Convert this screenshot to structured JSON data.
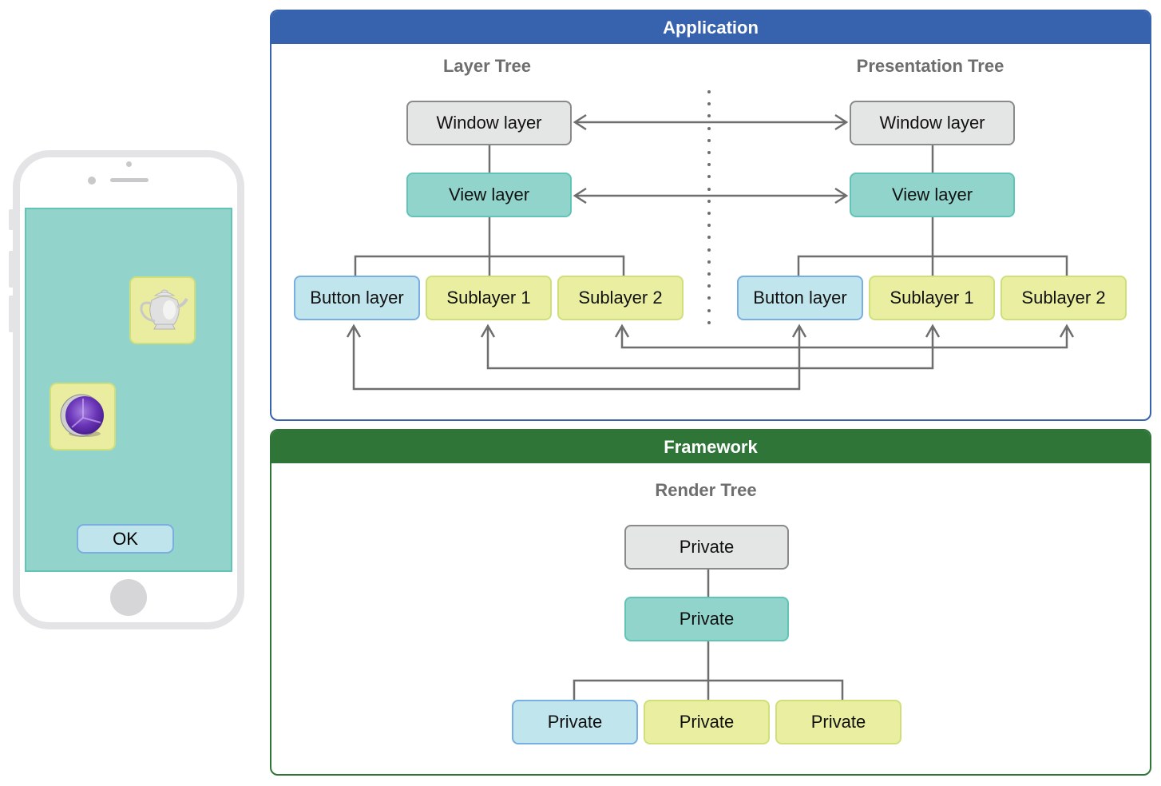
{
  "phone": {
    "screen_color": "#92d4cc",
    "icons": [
      {
        "name": "teapot",
        "semantic": "teapot-icon"
      },
      {
        "name": "purple-sphere",
        "semantic": "app-sphere-icon"
      }
    ],
    "ok_button_label": "OK"
  },
  "application": {
    "title": "Application",
    "color": "#3762ad",
    "layer_tree": {
      "title": "Layer Tree",
      "root": "Window layer",
      "child": "View layer",
      "leaves": [
        "Button layer",
        "Sublayer 1",
        "Sublayer 2"
      ]
    },
    "presentation_tree": {
      "title": "Presentation Tree",
      "root": "Window layer",
      "child": "View layer",
      "leaves": [
        "Button layer",
        "Sublayer 1",
        "Sublayer 2"
      ]
    }
  },
  "framework": {
    "title": "Framework",
    "color": "#2f7538",
    "render_tree": {
      "title": "Render Tree",
      "root": "Private",
      "child": "Private",
      "leaves": [
        "Private",
        "Private",
        "Private"
      ]
    }
  },
  "node_colors": {
    "window": "#e4e5e5",
    "view": "#91d4cb",
    "button": "#c1e5ec",
    "sublayer": "#eaeea0"
  }
}
